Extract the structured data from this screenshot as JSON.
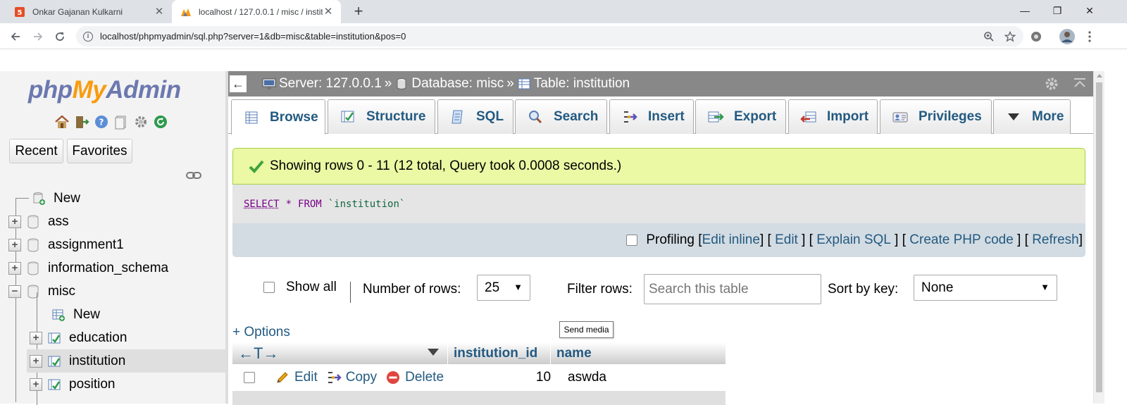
{
  "browser": {
    "tabs": [
      {
        "title": "Onkar Gajanan Kulkarni",
        "active": false
      },
      {
        "title": "localhost / 127.0.0.1 / misc / institution",
        "active": true
      }
    ],
    "url": "localhost/phpmyadmin/sql.php?server=1&db=misc&table=institution&pos=0"
  },
  "nav": {
    "logo": {
      "php": "php",
      "my": "My",
      "admin": "Admin"
    },
    "recent": "Recent",
    "favorites": "Favorites",
    "tree": [
      {
        "label": "New",
        "level": 0,
        "type": "new"
      },
      {
        "label": "ass",
        "level": 0,
        "type": "db",
        "expander": "+"
      },
      {
        "label": "assignment1",
        "level": 0,
        "type": "db",
        "expander": "+"
      },
      {
        "label": "information_schema",
        "level": 0,
        "type": "db",
        "expander": "+"
      },
      {
        "label": "misc",
        "level": 0,
        "type": "db",
        "expander": "−"
      },
      {
        "label": "New",
        "level": 1,
        "type": "new"
      },
      {
        "label": "education",
        "level": 1,
        "type": "table",
        "expander": "+"
      },
      {
        "label": "institution",
        "level": 1,
        "type": "table",
        "expander": "+",
        "selected": true
      },
      {
        "label": "position",
        "level": 1,
        "type": "table",
        "expander": "+"
      }
    ]
  },
  "breadcrumb": {
    "server": "Server: 127.0.0.1",
    "database": "Database: misc",
    "table": "Table: institution",
    "sep": "»"
  },
  "menu": [
    "Browse",
    "Structure",
    "SQL",
    "Search",
    "Insert",
    "Export",
    "Import",
    "Privileges",
    "More"
  ],
  "result": {
    "message": "Showing rows 0 - 11 (12 total, Query took 0.0008 seconds.)",
    "sql": {
      "select": "SELECT",
      "star": "*",
      "from": "FROM",
      "table": "`institution`"
    },
    "profiling": "Profiling",
    "links": {
      "edit_inline": "Edit inline",
      "edit": "Edit",
      "explain": "Explain SQL",
      "php": "Create PHP code",
      "refresh": "Refresh"
    }
  },
  "controls": {
    "show_all": "Show all",
    "rows_label": "Number of rows:",
    "rows_value": "25",
    "filter_label": "Filter rows:",
    "filter_placeholder": "Search this table",
    "sort_label": "Sort by key:",
    "sort_value": "None",
    "tooltip": "Send media",
    "options": "+ Options"
  },
  "table": {
    "columns": [
      "institution_id",
      "name"
    ],
    "rows": [
      {
        "institution_id": "10",
        "name": "aswda",
        "edit": "Edit",
        "copy": "Copy",
        "delete": "Delete"
      }
    ]
  }
}
